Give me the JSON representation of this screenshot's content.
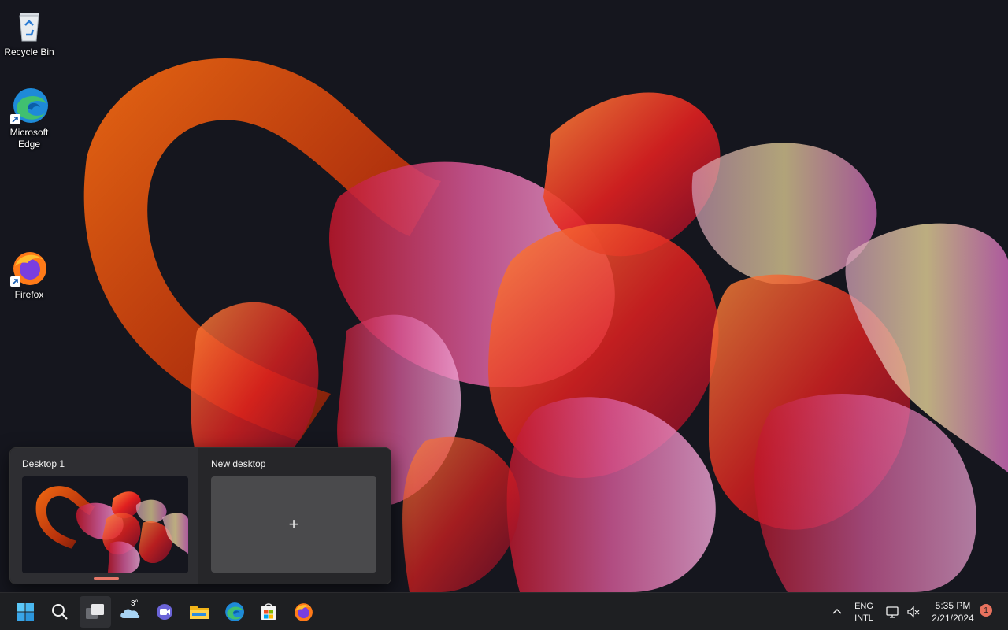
{
  "desktop": {
    "icons": [
      {
        "label": "Recycle Bin",
        "icon": "recycle-bin-icon"
      },
      {
        "label": "Microsoft Edge",
        "icon": "edge-icon"
      },
      {
        "label": "Firefox",
        "icon": "firefox-icon"
      }
    ]
  },
  "virtual_desktops": {
    "desktops": [
      {
        "title": "Desktop 1",
        "selected": true
      },
      {
        "title": "New desktop",
        "add_glyph": "+"
      }
    ]
  },
  "taskbar": {
    "items": [
      {
        "name": "start",
        "icon": "windows-logo-icon"
      },
      {
        "name": "search",
        "icon": "search-icon"
      },
      {
        "name": "task-view",
        "icon": "task-view-icon",
        "active": true
      },
      {
        "name": "widgets",
        "icon": "weather-cloud-icon",
        "badge": "3°"
      },
      {
        "name": "teams",
        "icon": "teams-chat-icon"
      },
      {
        "name": "file-explorer",
        "icon": "folder-icon"
      },
      {
        "name": "edge",
        "icon": "edge-icon"
      },
      {
        "name": "store",
        "icon": "store-icon"
      },
      {
        "name": "firefox",
        "icon": "firefox-icon"
      }
    ],
    "tray": {
      "language_top": "ENG",
      "language_bottom": "INTL",
      "time": "5:35 PM",
      "date": "2/21/2024",
      "notification_count": "1"
    }
  },
  "colors": {
    "accent": "#e87868",
    "taskbar_bg": "#1e1f22",
    "panel_bg": "#262629"
  }
}
